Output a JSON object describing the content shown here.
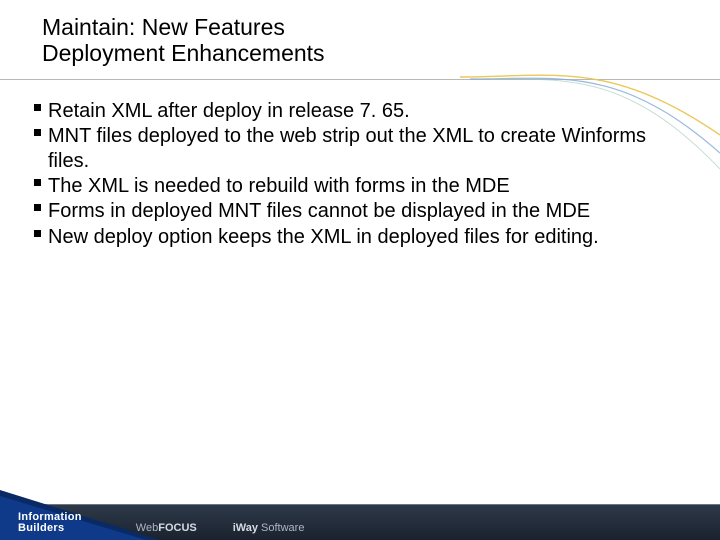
{
  "header": {
    "title_line1": "Maintain: New Features",
    "title_line2": "Deployment Enhancements"
  },
  "bullets": [
    "Retain XML after deploy in release 7. 65.",
    "MNT files deployed to the web strip out the XML to create Winforms files.",
    "The XML is needed to rebuild with forms in the MDE",
    "Forms in deployed MNT files cannot be displayed in the MDE",
    "New deploy option keeps the XML in deployed files for editing."
  ],
  "footer": {
    "logo_ib_line1": "Information",
    "logo_ib_line2": "Builders",
    "logo_webfocus_prefix": "Web",
    "logo_webfocus_suffix": "FOCUS",
    "logo_iway_prefix": "iWay",
    "logo_iway_suffix": " Software"
  }
}
